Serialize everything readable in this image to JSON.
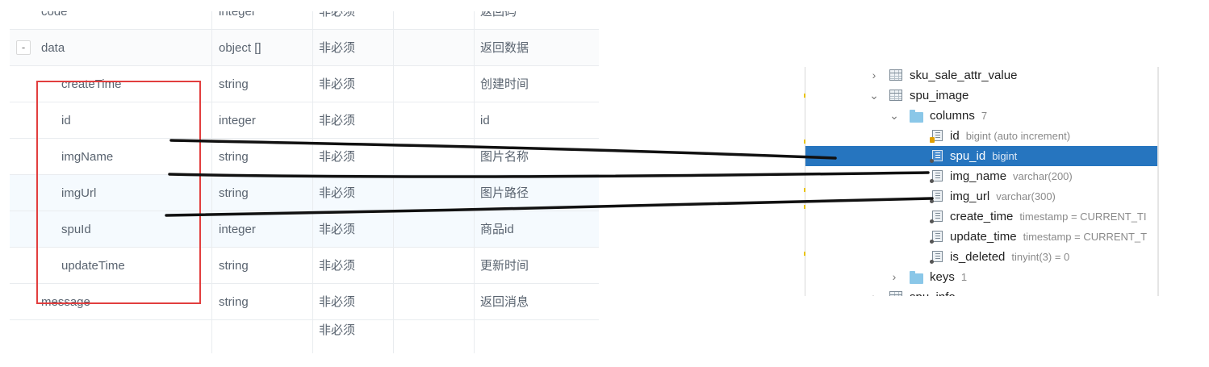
{
  "api_table": {
    "rows": [
      {
        "name": "code",
        "type": "integer",
        "required": "非必须",
        "desc": "返回码"
      },
      {
        "name": "data",
        "type": "object []",
        "required": "非必须",
        "desc": "返回数据",
        "toggle": "-"
      },
      {
        "name": "createTime",
        "type": "string",
        "required": "非必须",
        "desc": "创建时间"
      },
      {
        "name": "id",
        "type": "integer",
        "required": "非必须",
        "desc": "id"
      },
      {
        "name": "imgName",
        "type": "string",
        "required": "非必须",
        "desc": "图片名称"
      },
      {
        "name": "imgUrl",
        "type": "string",
        "required": "非必须",
        "desc": "图片路径"
      },
      {
        "name": "spuId",
        "type": "integer",
        "required": "非必须",
        "desc": "商品id"
      },
      {
        "name": "updateTime",
        "type": "string",
        "required": "非必须",
        "desc": "更新时间"
      },
      {
        "name": "message",
        "type": "string",
        "required": "非必须",
        "desc": "返回消息"
      },
      {
        "name": "",
        "type": "",
        "required": "非必须",
        "desc": ""
      }
    ]
  },
  "db_tree": {
    "items": [
      {
        "label": "sku_sale_attr_value",
        "kind": "table",
        "expanded": false
      },
      {
        "label": "spu_image",
        "kind": "table",
        "expanded": true
      },
      {
        "label": "columns",
        "count": "7",
        "kind": "folder",
        "expanded": true
      },
      {
        "label": "id",
        "type": "bigint (auto increment)",
        "kind": "key-column"
      },
      {
        "label": "spu_id",
        "type": "bigint",
        "kind": "column",
        "selected": true
      },
      {
        "label": "img_name",
        "type": "varchar(200)",
        "kind": "column"
      },
      {
        "label": "img_url",
        "type": "varchar(300)",
        "kind": "column"
      },
      {
        "label": "create_time",
        "type": "timestamp = CURRENT_TI",
        "kind": "column"
      },
      {
        "label": "update_time",
        "type": "timestamp = CURRENT_T",
        "kind": "column"
      },
      {
        "label": "is_deleted",
        "type": "tinyint(3) = 0",
        "kind": "column"
      },
      {
        "label": "keys",
        "count": "1",
        "kind": "folder",
        "expanded": false
      },
      {
        "label": "spu_info",
        "kind": "table",
        "expanded": false
      }
    ]
  },
  "colors": {
    "selection": "#2675bf",
    "highlight_box": "#e23e3e",
    "ink": "#111111",
    "gutter_marker": "#e8c200"
  },
  "icons": {
    "table": "table-grid-icon",
    "folder": "folder-icon",
    "column": "column-icon",
    "key_column": "primary-key-column-icon",
    "expand": "chevron-right-icon",
    "collapse": "chevron-down-icon"
  }
}
